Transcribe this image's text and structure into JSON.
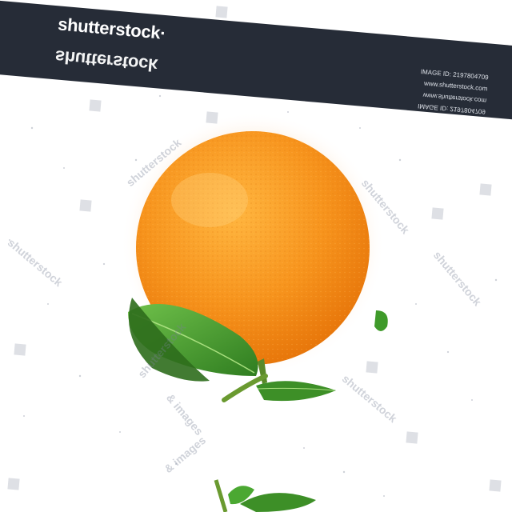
{
  "brand": {
    "logo_text": "shutterstock",
    "logo_mark": "·"
  },
  "banner": {
    "image_id": "IMAGE ID: 2197804709",
    "site": "www.shutterstock.com",
    "image_id_mirrored": "IMAGE ID: 2197804709",
    "site_mirrored": "www.shutterstock.com"
  },
  "watermarks": {
    "text": "shutterstock",
    "images_text": "& images"
  },
  "colors": {
    "banner": "#262c37",
    "orange": "#f7941d",
    "leaf": "#3f9a2a"
  }
}
